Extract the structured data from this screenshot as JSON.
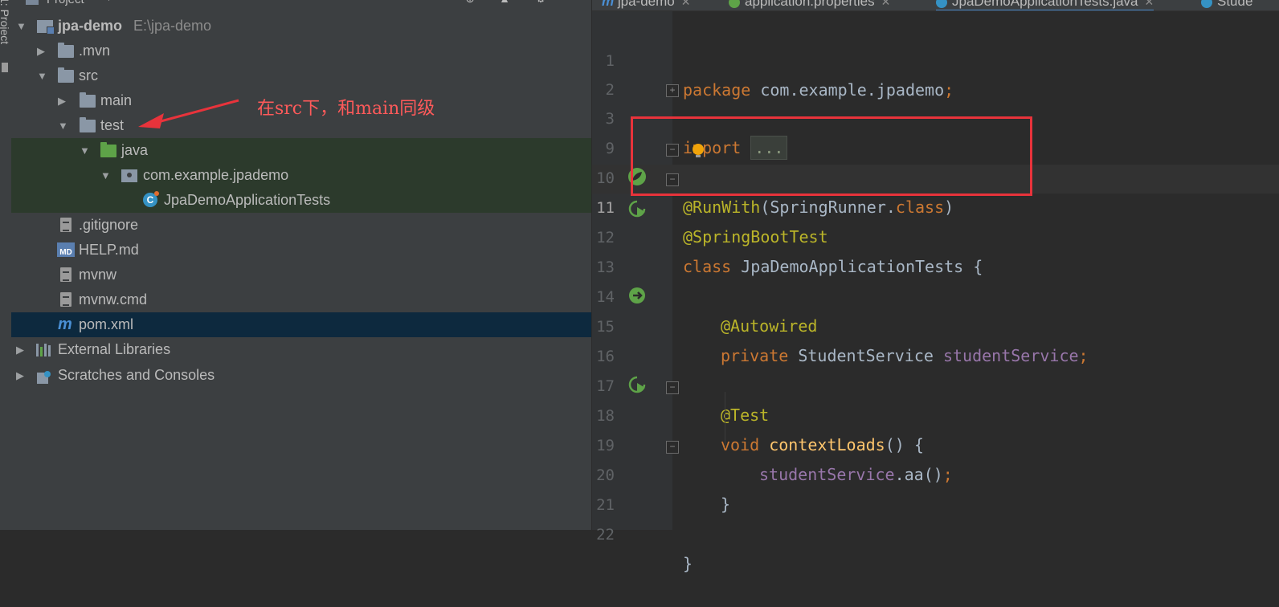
{
  "toolwindow": {
    "strip_label": "1: Project"
  },
  "project_panel": {
    "title": "Project",
    "tree": [
      {
        "label": "jpa-demo",
        "path": "E:\\jpa-demo",
        "icon": "module-folder-icon",
        "expanded": true
      },
      {
        "label": ".mvn",
        "icon": "folder-icon",
        "expanded": false
      },
      {
        "label": "src",
        "icon": "folder-icon",
        "expanded": true
      },
      {
        "label": "main",
        "icon": "folder-icon",
        "expanded": false
      },
      {
        "label": "test",
        "icon": "folder-icon",
        "expanded": true
      },
      {
        "label": "java",
        "icon": "test-source-folder-icon",
        "expanded": true
      },
      {
        "label": "com.example.jpademo",
        "icon": "package-icon",
        "expanded": true
      },
      {
        "label": "JpaDemoApplicationTests",
        "icon": "test-class-icon"
      },
      {
        "label": ".gitignore",
        "icon": "text-file-icon"
      },
      {
        "label": "HELP.md",
        "icon": "markdown-file-icon",
        "icon_text": "MD"
      },
      {
        "label": "mvnw",
        "icon": "text-file-icon"
      },
      {
        "label": "mvnw.cmd",
        "icon": "text-file-icon"
      },
      {
        "label": "pom.xml",
        "icon": "maven-icon",
        "icon_text": "m"
      },
      {
        "label": "External Libraries",
        "icon": "libraries-icon",
        "expanded": false
      },
      {
        "label": "Scratches and Consoles",
        "icon": "scratches-icon",
        "expanded": false
      }
    ],
    "annotation": "在src下，和main同级"
  },
  "editor_tabs": [
    {
      "label": "jpa-demo",
      "icon": "maven-icon",
      "icon_text": "m"
    },
    {
      "label": "application.properties",
      "icon": "properties-file-icon"
    },
    {
      "label": "JpaDemoApplicationTests.java",
      "icon": "test-class-icon",
      "active": true
    },
    {
      "label": "Stude",
      "icon": "class-icon"
    }
  ],
  "editor": {
    "line_numbers": [
      "1",
      "2",
      "3",
      "9",
      "10",
      "11",
      "12",
      "13",
      "14",
      "15",
      "16",
      "17",
      "18",
      "19",
      "20",
      "21",
      "22"
    ],
    "code": {
      "l1_kw": "package",
      "l1_rest": " com.example.jpademo",
      "l1_semi": ";",
      "l3_kw": "import",
      "l3_fold": "...",
      "l10_at": "@",
      "l10_ann": "RunWith",
      "l10_paren_open": "(SpringRunner.",
      "l10_class": "class",
      "l10_paren_close": ")",
      "l11_ann": "@SpringBootTest",
      "l12_kw": "class",
      "l12_rest": " JpaDemoApplicationTests {",
      "l14_ann": "@Autowired",
      "l15_kw": "private",
      "l15_type": " StudentService ",
      "l15_field": "studentService",
      "l15_semi": ";",
      "l17_ann": "@Test",
      "l18_kw": "void",
      "l18_fn": " contextLoads",
      "l18_rest": "() {",
      "l19_field": "studentService",
      "l19_rest": ".aa()",
      "l19_semi": ";",
      "l20_brace": "}",
      "l22_brace": "}"
    }
  },
  "colors": {
    "annotation_red": "#e8333b",
    "keyword": "#cc7832",
    "annotation_yellow": "#bbb529",
    "field_purple": "#9876aa",
    "method_gold": "#ffc66d"
  }
}
